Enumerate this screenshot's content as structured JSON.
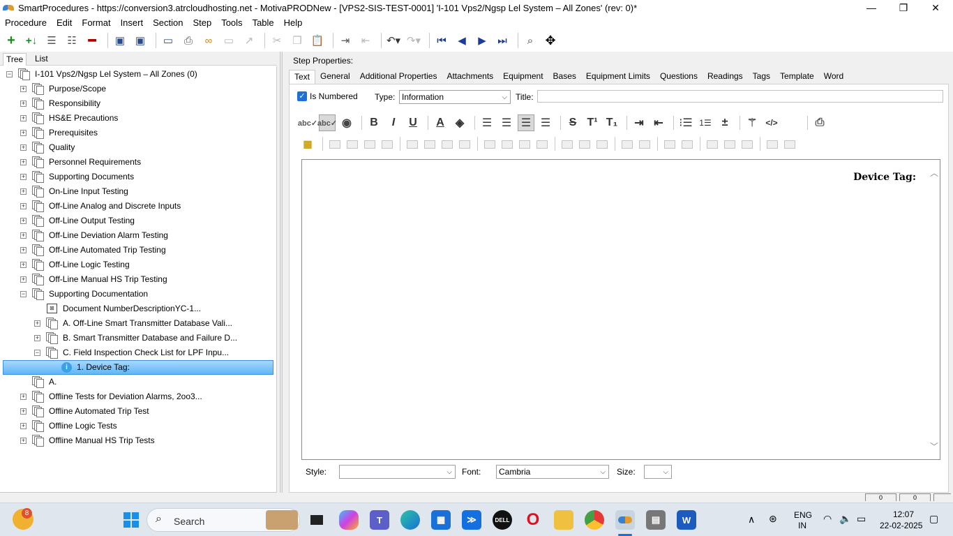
{
  "window": {
    "title": "SmartProcedures - https://conversion3.atrcloudhosting.net - MotivaPRODNew - [VPS2-SIS-TEST-0001] 'I-101 Vps2/Ngsp Lel System – All Zones' (rev: 0)*",
    "minimize": "—",
    "maximize": "❐",
    "close": "✕"
  },
  "menu": [
    "Procedure",
    "Edit",
    "Format",
    "Insert",
    "Section",
    "Step",
    "Tools",
    "Table",
    "Help"
  ],
  "left_tabs": [
    "Tree",
    "List"
  ],
  "tree": {
    "root": "I-101 Vps2/Ngsp Lel System – All Zones (0)",
    "items": [
      {
        "label": "Purpose/Scope",
        "exp": "+"
      },
      {
        "label": "Responsibility",
        "exp": "+"
      },
      {
        "label": "HS&E Precautions",
        "exp": "+"
      },
      {
        "label": "Prerequisites",
        "exp": "+"
      },
      {
        "label": "Quality",
        "exp": "+"
      },
      {
        "label": "Personnel Requirements",
        "exp": "+"
      },
      {
        "label": "Supporting Documents",
        "exp": "+"
      },
      {
        "label": "On-Line Input Testing",
        "exp": "+"
      },
      {
        "label": "Off-Line Analog and Discrete Inputs",
        "exp": "+"
      },
      {
        "label": "Off-Line Output Testing",
        "exp": "+"
      },
      {
        "label": "Off-Line Deviation Alarm Testing",
        "exp": "+"
      },
      {
        "label": "Off-Line Automated Trip Testing",
        "exp": "+"
      },
      {
        "label": "Off-Line Logic Testing",
        "exp": "+"
      },
      {
        "label": "Off-Line Manual HS Trip Testing",
        "exp": "+"
      },
      {
        "label": "Supporting Documentation",
        "exp": "−"
      },
      {
        "label": "Document NumberDescriptionYC-1...",
        "exp": ""
      },
      {
        "label": "A. Off-Line Smart Transmitter Database Vali...",
        "exp": "+"
      },
      {
        "label": "B. Smart Transmitter Database and Failure D...",
        "exp": "+"
      },
      {
        "label": "C. Field Inspection Check List for LPF Inpu...",
        "exp": "−"
      },
      {
        "label": "1. Device Tag:",
        "exp": ""
      },
      {
        "label": "A.",
        "exp": ""
      },
      {
        "label": "Offline Tests for Deviation Alarms, 2oo3...",
        "exp": "+"
      },
      {
        "label": "Offline Automated Trip Test",
        "exp": "+"
      },
      {
        "label": "Offline Logic Tests",
        "exp": "+"
      },
      {
        "label": "Offline Manual HS Trip Tests",
        "exp": "+"
      }
    ]
  },
  "step_properties": {
    "heading": "Step Properties:",
    "tabs": [
      "Text",
      "General",
      "Additional Properties",
      "Attachments",
      "Equipment",
      "Bases",
      "Equipment Limits",
      "Questions",
      "Readings",
      "Tags",
      "Template",
      "Word"
    ],
    "is_numbered_label": "Is Numbered",
    "type_label": "Type:",
    "type_value": "Information",
    "title_label": "Title:",
    "title_value": "",
    "editor_text": "Device Tag:",
    "style_label": "Style:",
    "style_value": "",
    "font_label": "Font:",
    "font_value": "Cambria",
    "size_label": "Size:",
    "size_value": ""
  },
  "status_boxes": [
    "0",
    "0"
  ],
  "taskbar": {
    "search_label": "Search",
    "notification_count": "8",
    "language": "ENG",
    "region": "IN",
    "time": "12:07",
    "date": "22-02-2025"
  }
}
